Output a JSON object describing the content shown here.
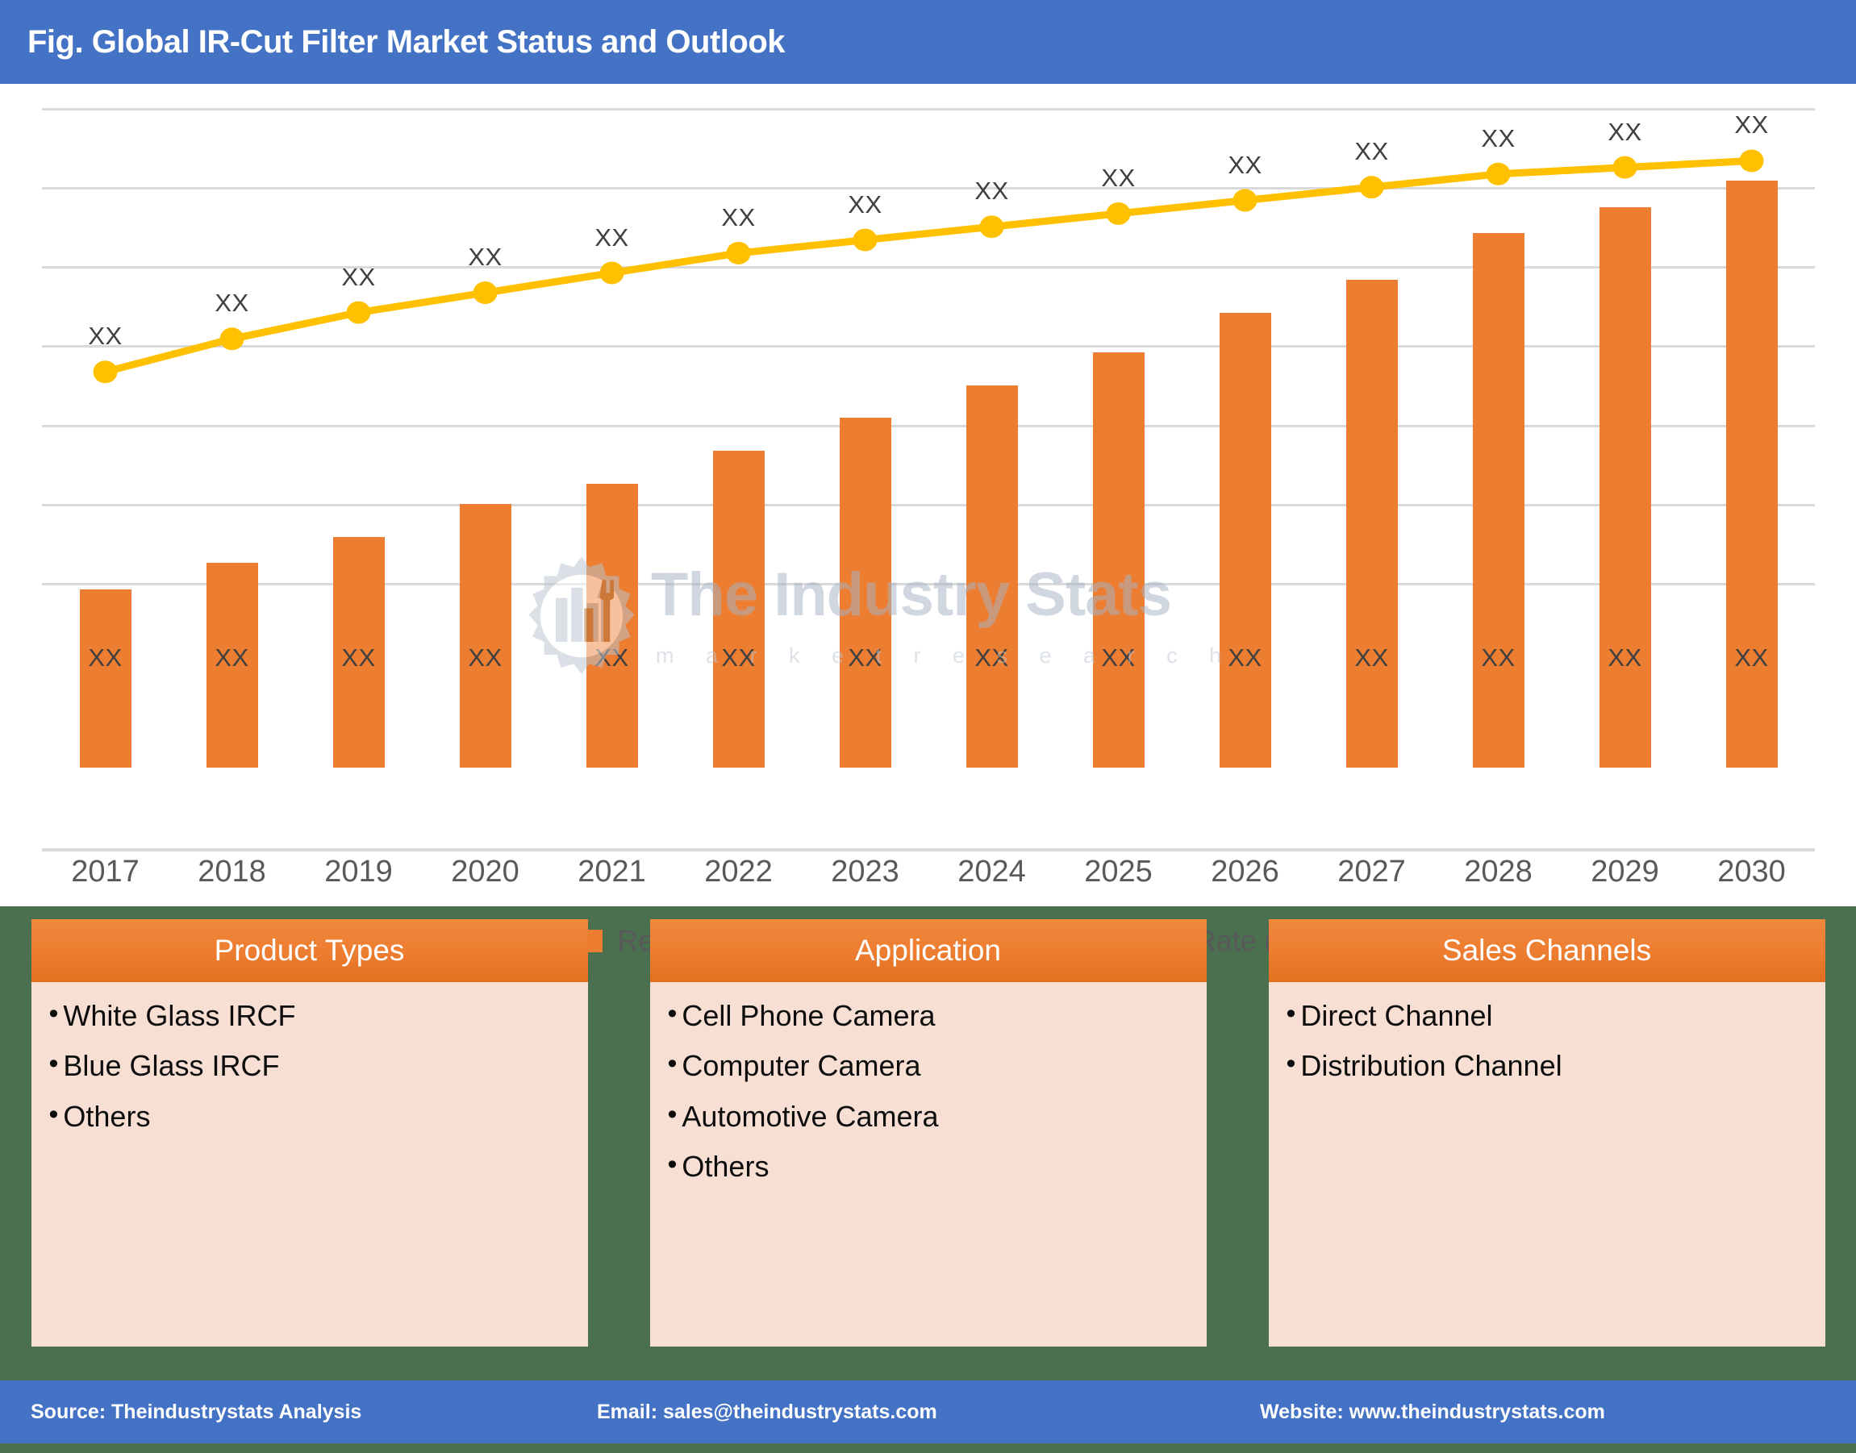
{
  "header": {
    "title": "Fig. Global IR-Cut Filter Market Status and Outlook",
    "bar_color": "#4472C4"
  },
  "watermark": {
    "title": "The Industry Stats",
    "subtitle": "m a r k e t   r e s e a r c h",
    "logo_icon": "gear-factory-logo-icon"
  },
  "chart_data": {
    "type": "bar",
    "title": "Fig. Global IR-Cut Filter Market Status and Outlook",
    "xlabel": "",
    "ylabel": "",
    "grid": true,
    "legend_position": "bottom",
    "categories": [
      "2017",
      "2018",
      "2019",
      "2020",
      "2021",
      "2022",
      "2023",
      "2024",
      "2025",
      "2026",
      "2027",
      "2028",
      "2029",
      "2030"
    ],
    "bar_value_labels": [
      "XX",
      "XX",
      "XX",
      "XX",
      "XX",
      "XX",
      "XX",
      "XX",
      "XX",
      "XX",
      "XX",
      "XX",
      "XX",
      "XX"
    ],
    "line_value_labels": [
      "XX",
      "XX",
      "XX",
      "XX",
      "XX",
      "XX",
      "XX",
      "XX",
      "XX",
      "XX",
      "XX",
      "XX",
      "XX",
      "XX"
    ],
    "series": [
      {
        "name": "Revenue (Million $)",
        "type": "bar",
        "color": "#ED7D31",
        "values": [
          27,
          31,
          35,
          40,
          43,
          48,
          53,
          58,
          63,
          69,
          74,
          81,
          85,
          89
        ],
        "labels": [
          "XX",
          "XX",
          "XX",
          "XX",
          "XX",
          "XX",
          "XX",
          "XX",
          "XX",
          "XX",
          "XX",
          "XX",
          "XX",
          "XX"
        ]
      },
      {
        "name": "Y-oY Growth Rate (%)",
        "type": "line",
        "color": "#FFC000",
        "values": [
          60,
          65,
          69,
          72,
          75,
          78,
          80,
          82,
          84,
          86,
          88,
          90,
          91,
          92
        ],
        "labels": [
          "XX",
          "XX",
          "XX",
          "XX",
          "XX",
          "XX",
          "XX",
          "XX",
          "XX",
          "XX",
          "XX",
          "XX",
          "XX",
          "XX"
        ]
      }
    ],
    "ylim": [
      0,
      100
    ]
  },
  "legend": {
    "revenue_label": "Revenue (Million $)",
    "growth_label": "Y-oY Growth Rate (%)"
  },
  "panels": [
    {
      "header": "Product Types",
      "items": [
        "White Glass IRCF",
        "Blue Glass IRCF",
        "Others"
      ]
    },
    {
      "header": "Application",
      "items": [
        "Cell Phone Camera",
        "Computer Camera",
        "Automotive Camera",
        "Others"
      ]
    },
    {
      "header": "Sales Channels",
      "items": [
        "Direct Channel",
        "Distribution Channel"
      ]
    }
  ],
  "footer": {
    "source": "Source: Theindustrystats Analysis",
    "email": "Email: sales@theindustrystats.com",
    "website": "Website: www.theindustrystats.com",
    "bar_color": "#4472C4"
  }
}
